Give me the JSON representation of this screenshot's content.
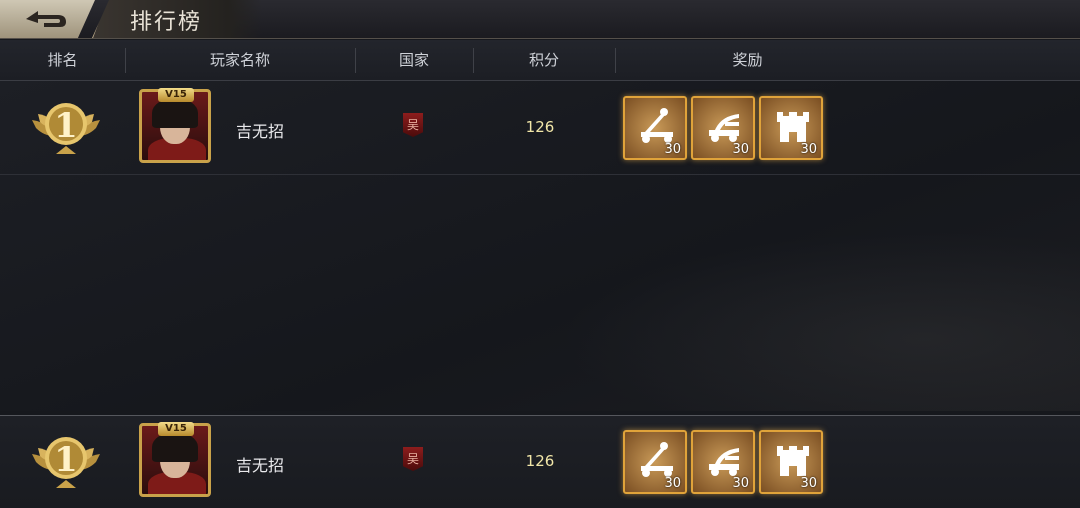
{
  "title": "排行榜",
  "headers": [
    "排名",
    "玩家名称",
    "国家",
    "积分",
    "奖励"
  ],
  "rows": [
    {
      "rank": "1",
      "vip": "V15",
      "name": "吉无招",
      "country": "吴",
      "score": "126",
      "rewards": [
        {
          "icon": "catapult-icon",
          "count": "30"
        },
        {
          "icon": "ballista-icon",
          "count": "30"
        },
        {
          "icon": "fortress-icon",
          "count": "30"
        }
      ]
    },
    {
      "rank": "1",
      "vip": "V15",
      "name": "吉无招",
      "country": "吴",
      "score": "126",
      "rewards": [
        {
          "icon": "catapult-icon",
          "count": "30"
        },
        {
          "icon": "ballista-icon",
          "count": "30"
        },
        {
          "icon": "fortress-icon",
          "count": "30"
        }
      ]
    }
  ],
  "colors": {
    "gold": "#c9a24a",
    "accent_border": "#e0a33a",
    "score": "#f1e6a8",
    "country": "#8d1d1d"
  }
}
